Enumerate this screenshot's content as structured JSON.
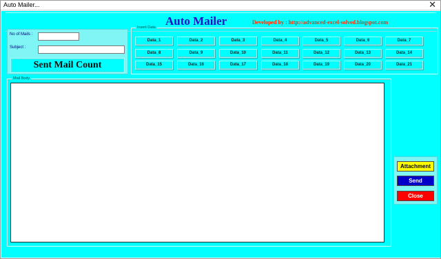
{
  "window": {
    "title": "Auto Mailer...",
    "close_glyph": "✕"
  },
  "header": {
    "app_title": "Auto Mailer",
    "developer_credit": "Developed by : http://advanced-excel-solved.blogspot.com"
  },
  "fields": {
    "no_of_mails_label": "No of Mails :",
    "no_of_mails_value": "",
    "subject_label": "Subject :",
    "subject_value": ""
  },
  "sent_mail_count_label": "Sent Mail Count",
  "insert_data": {
    "legend": "Insert Data",
    "buttons": [
      "Data_1",
      "Data_2",
      "Data_3",
      "Data_4",
      "Data_5",
      "Data_6",
      "Data_7",
      "Data_8",
      "Data_9",
      "Data_10",
      "Data_11",
      "Data_12",
      "Data_13",
      "Data_14",
      "Data_15",
      "Data_16",
      "Data_17",
      "Data_18",
      "Data_19",
      "Data_20",
      "Data_21"
    ]
  },
  "mail_body": {
    "legend": "Mail Body",
    "value": ""
  },
  "actions": {
    "attachment_label": "Attachment",
    "send_label": "Send",
    "close_label": "Close"
  },
  "colors": {
    "form_background": "#00ffff",
    "title_color": "#1a13c8",
    "credit_color": "#ff2a00",
    "attachment_bg": "#ffff00",
    "send_bg": "#0000c8",
    "close_bg": "#ff0000"
  }
}
